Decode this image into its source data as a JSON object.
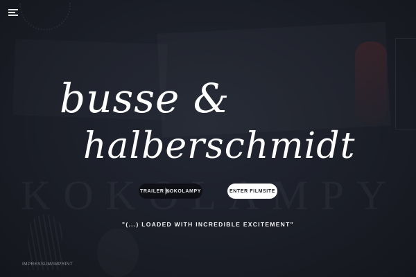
{
  "header": {
    "menu_icon": "hamburger-menu-icon"
  },
  "logo": {
    "line1": "busse &",
    "line2": "halberschmidt"
  },
  "background": {
    "title_text": "KOKOLAMPY"
  },
  "buttons": {
    "trailer_label": "TRAILER KOKOLAMPY",
    "trailer_icon": "play-icon",
    "enter_label": "ENTER FILMSITE"
  },
  "quote": "\"(...) LOADED WITH INCREDIBLE EXCITEMENT\"",
  "footer": {
    "imprint_label": "IMPRESSUM/IMPRINT"
  },
  "colors": {
    "background": "#191c24",
    "text": "#ffffff",
    "trailer_button": "#0e1015",
    "enter_button": "#ffffff"
  }
}
